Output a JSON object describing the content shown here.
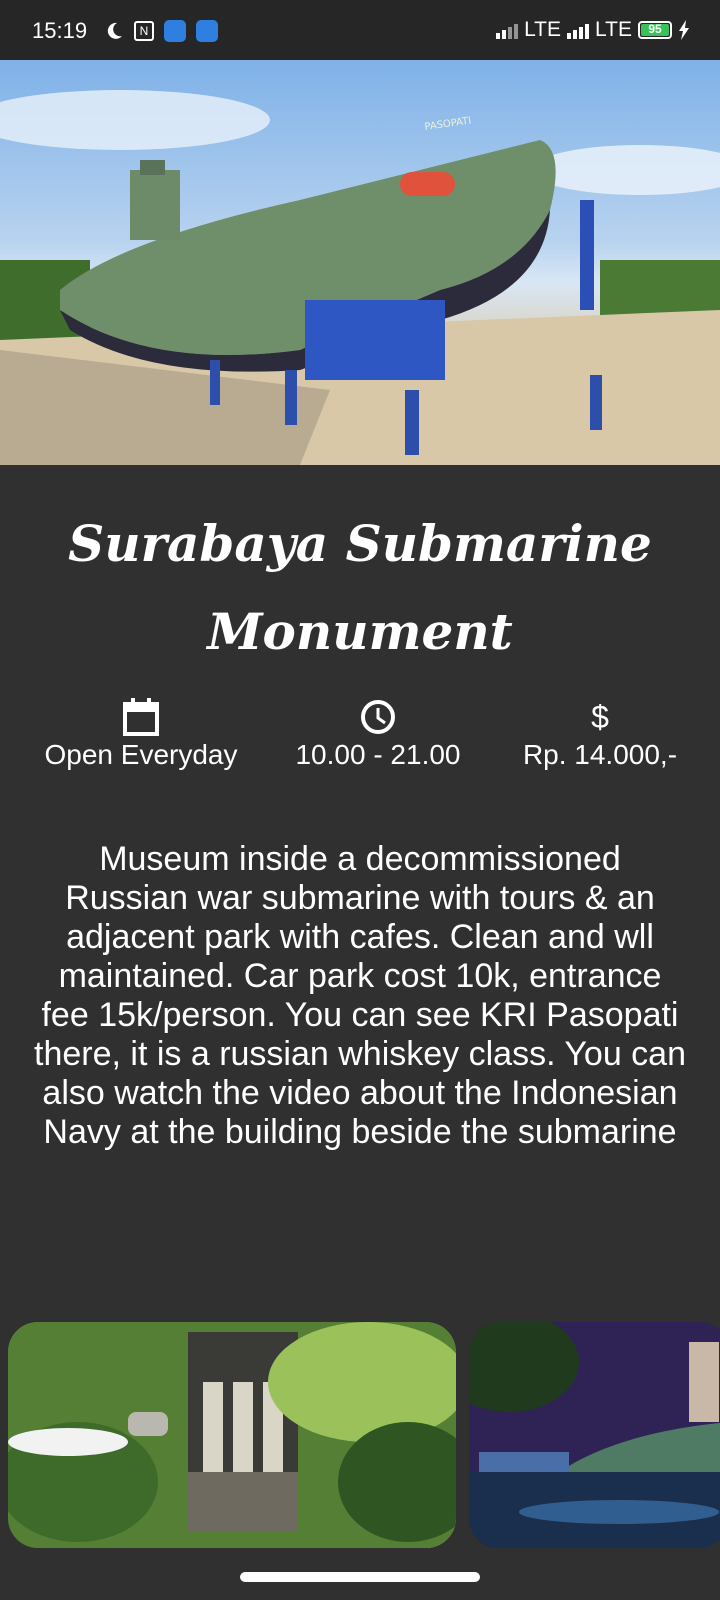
{
  "status_bar": {
    "time": "15:19",
    "network1": "LTE",
    "network2": "LTE",
    "battery": "95"
  },
  "hero": {
    "image_text": "PASOPATI"
  },
  "place": {
    "title": "Surabaya Submarine Monument",
    "open_days": "Open Everyday",
    "hours": "10.00 - 21.00",
    "price_symbol": "$",
    "price": "Rp. 14.000,-",
    "description": "Museum inside a decommissioned Russian war submarine with tours & an adjacent park with cafes. Clean and wll maintained. Car park cost 10k, entrance fee 15k/person. You can see KRI Pasopati there, it is a russian whiskey class. You can also watch the video about the Indonesian Navy at the building beside the submarine"
  },
  "icons": {
    "calendar": "calendar-icon",
    "clock": "clock-icon",
    "price": "dollar-icon"
  },
  "colors": {
    "background": "#303030",
    "status_bar": "#262626",
    "text": "#ffffff",
    "battery": "#3ac25a"
  }
}
